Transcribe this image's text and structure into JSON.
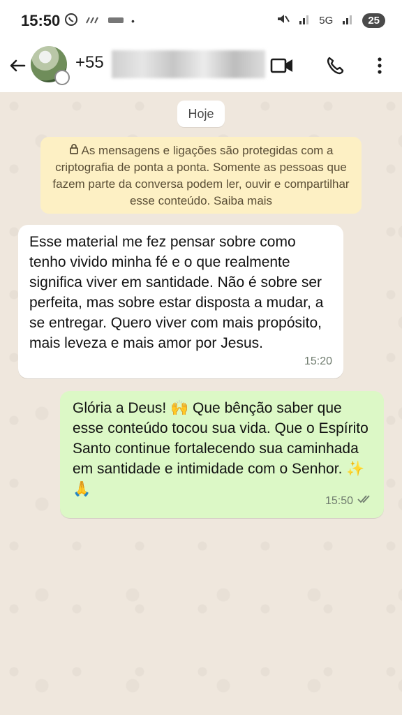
{
  "status_bar": {
    "time": "15:50",
    "left_icons": [
      "whatsapp-icon",
      "signal-activity-icon",
      "app-icon"
    ],
    "dot": "•",
    "right_icons": [
      "mute-icon",
      "signal-icon",
      "5g-icon",
      "signal-icon-2"
    ],
    "network": "5G",
    "battery": "25"
  },
  "header": {
    "contact_prefix": "+55",
    "icons": [
      "back-arrow-icon",
      "video-call-icon",
      "phone-call-icon",
      "more-vert-icon"
    ]
  },
  "chat": {
    "date_chip": "Hoje",
    "encryption_notice": "As mensagens e ligações são protegidas com a criptografia de ponta a ponta. Somente as pessoas que fazem parte da conversa podem ler, ouvir e compartilhar esse conteúdo. Saiba mais",
    "messages": [
      {
        "direction": "incoming",
        "text": "Esse material me fez pensar sobre como tenho vivido minha fé e o que realmente significa viver em santidade. Não é sobre ser perfeita, mas sobre estar disposta a mudar, a se entregar. Quero viver com mais propósito, mais leveza e mais amor por Jesus.",
        "time": "15:20"
      },
      {
        "direction": "outgoing",
        "text": "Glória a Deus! 🙌 Que bênção saber que esse conteúdo tocou sua vida. Que o Espírito Santo continue fortalecendo sua caminhada em santidade e intimidade com o Senhor. ✨🙏",
        "time": "15:50",
        "status": "read"
      }
    ]
  },
  "colors": {
    "chat_bg": "#efe7dd",
    "incoming_bubble": "#ffffff",
    "outgoing_bubble": "#dcf8c6",
    "notice_bg": "#fdf0c4"
  }
}
